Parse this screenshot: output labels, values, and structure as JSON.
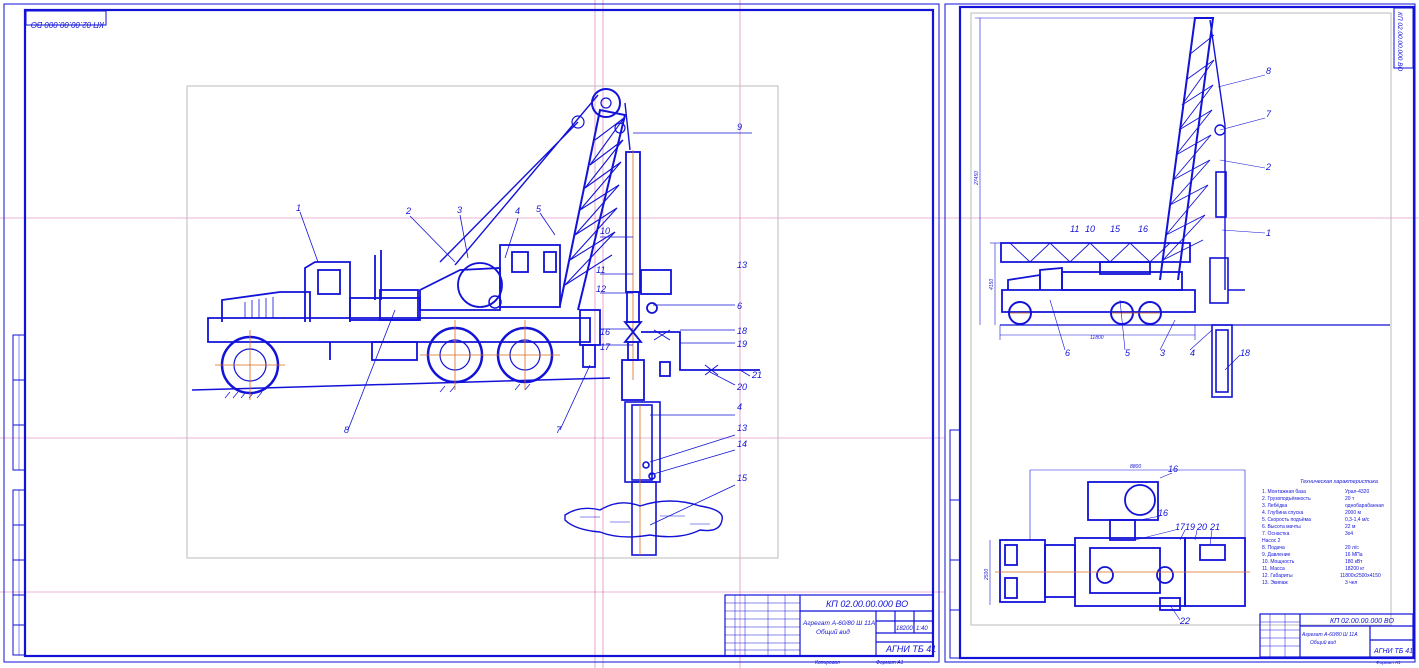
{
  "left_sheet": {
    "corner_stamp": "КП 02.00.00.000 ВО",
    "title_block": {
      "code": "КП 02.00.00.000 ВО",
      "name_line1": "Агрегат А-60/80 Ш 11А",
      "name_line2": "Общий вид",
      "mass": "18200",
      "scale": "1:40",
      "group": "АГНИ ТБ 41",
      "sheet_footer": "Копировал",
      "format": "Формат А1"
    },
    "callouts": [
      "1",
      "2",
      "3",
      "4",
      "5",
      "6",
      "7",
      "8",
      "9",
      "10",
      "11",
      "12",
      "13",
      "14",
      "15",
      "16",
      "17",
      "18",
      "19",
      "20",
      "21",
      "4",
      "13",
      "14",
      "15"
    ]
  },
  "right_sheet": {
    "corner_stamp": "КП 02.00.00.000 ВО",
    "dimensions": {
      "height_total": "27450",
      "height_low": "4150",
      "length_base": "11800",
      "plan_width": "2500",
      "plan_length": "8800"
    },
    "callouts_top": [
      "8",
      "7",
      "2",
      "1",
      "11",
      "10",
      "15",
      "16",
      "3",
      "4",
      "5",
      "6",
      "18"
    ],
    "callouts_plan": [
      "16",
      "17",
      "19",
      "20",
      "21",
      "16",
      "22"
    ],
    "tech_spec_title": "Техническая характеристика",
    "tech_spec": [
      {
        "label": "1. Монтажная база",
        "value": "Урал-4320"
      },
      {
        "label": "2. Грузоподъёмность",
        "value": "20 т"
      },
      {
        "label": "3. Лебёдка",
        "value": "однобарабанная"
      },
      {
        "label": "4. Глубина спуска",
        "value": "2000 м"
      },
      {
        "label": "5. Скорость подъёма",
        "value": "0,3-1,4 м/с"
      },
      {
        "label": "6. Высота мачты",
        "value": "22 м"
      },
      {
        "label": "7. Оснастка",
        "value": "3x4"
      },
      {
        "label": "Насос 2",
        "value": ""
      },
      {
        "label": "8. Подача",
        "value": "20 л/с"
      },
      {
        "label": "9. Давление",
        "value": "16 МПа"
      },
      {
        "label": "10. Мощность",
        "value": "180 кВт"
      },
      {
        "label": "11. Масса",
        "value": "18200 кг"
      },
      {
        "label": "12. Габариты",
        "value": "11800x2500x4150"
      },
      {
        "label": "13. Экипаж",
        "value": "3 чел"
      }
    ],
    "title_block": {
      "code": "КП 02.00.00.000 ВО",
      "name_line1": "Агрегат А-60/80 Ш 11А",
      "name_line2": "Общий вид",
      "group": "АГНИ ТБ 41",
      "format": "Формат А1"
    }
  },
  "colors": {
    "line": "#1212d8",
    "axis": "#d86a1a",
    "guide": "#c0308a",
    "paper": "#ffffff"
  }
}
